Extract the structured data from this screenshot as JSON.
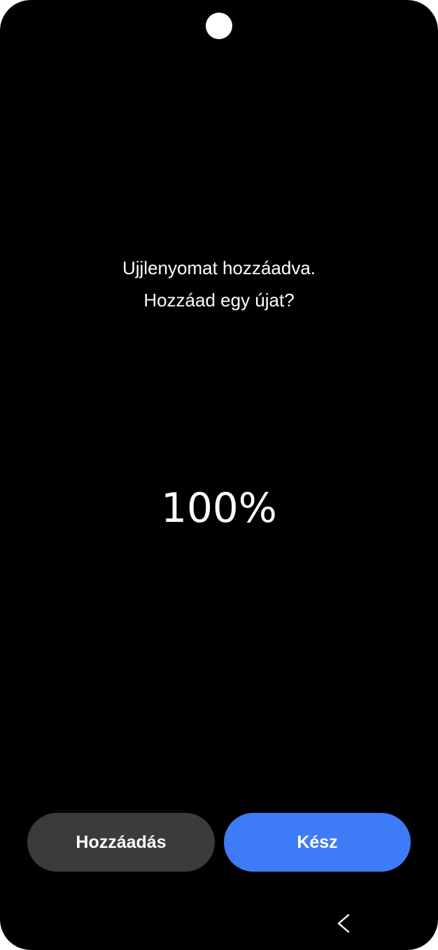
{
  "status": {
    "line1": "Ujjlenyomat hozzáadva.",
    "line2": "Hozzáad egy újat?"
  },
  "progress": {
    "value": 100,
    "label": "100%"
  },
  "buttons": {
    "add_label": "Hozzáadás",
    "done_label": "Kész"
  },
  "navigation": {
    "back_icon": "chevron-left-icon"
  },
  "colors": {
    "background": "#000000",
    "secondary_button": "#3b3b3b",
    "primary_button": "#3e7bf7",
    "text": "#ffffff"
  }
}
